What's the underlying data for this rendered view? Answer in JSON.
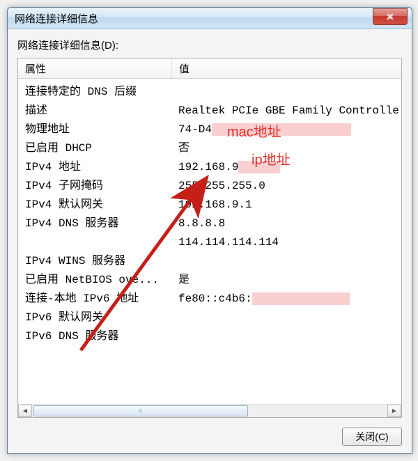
{
  "window": {
    "title": "网络连接详细信息",
    "close_glyph": "✕"
  },
  "section_label": "网络连接详细信息(D):",
  "columns": {
    "prop": "属性",
    "val": "值"
  },
  "rows": [
    {
      "prop": "连接特定的 DNS 后缀",
      "val": ""
    },
    {
      "prop": "描述",
      "val": "Realtek PCIe GBE Family Controlle"
    },
    {
      "prop": "物理地址",
      "val": "74-D4",
      "redact_after": true,
      "redact_w": 200
    },
    {
      "prop": "已启用 DHCP",
      "val": "否"
    },
    {
      "prop": "IPv4 地址",
      "val": "192.168.9",
      "redact_after": true,
      "redact_w": 60
    },
    {
      "prop": "IPv4 子网掩码",
      "val": "255.255.255.0"
    },
    {
      "prop": "IPv4 默认网关",
      "val": "192.168.9.1"
    },
    {
      "prop": "IPv4 DNS 服务器",
      "val": "8.8.8.8"
    },
    {
      "prop": "",
      "val": "114.114.114.114"
    },
    {
      "prop": "IPv4 WINS 服务器",
      "val": ""
    },
    {
      "prop": "已启用 NetBIOS ove...",
      "val": "是"
    },
    {
      "prop": "连接-本地 IPv6 地址",
      "val": "fe80::c4b6:",
      "redact_after": true,
      "redact_w": 140
    },
    {
      "prop": "IPv6 默认网关",
      "val": ""
    },
    {
      "prop": "IPv6 DNS 服务器",
      "val": ""
    }
  ],
  "annotations": {
    "mac": "mac地址",
    "ip": "ip地址"
  },
  "buttons": {
    "close": "关闭(C)"
  }
}
